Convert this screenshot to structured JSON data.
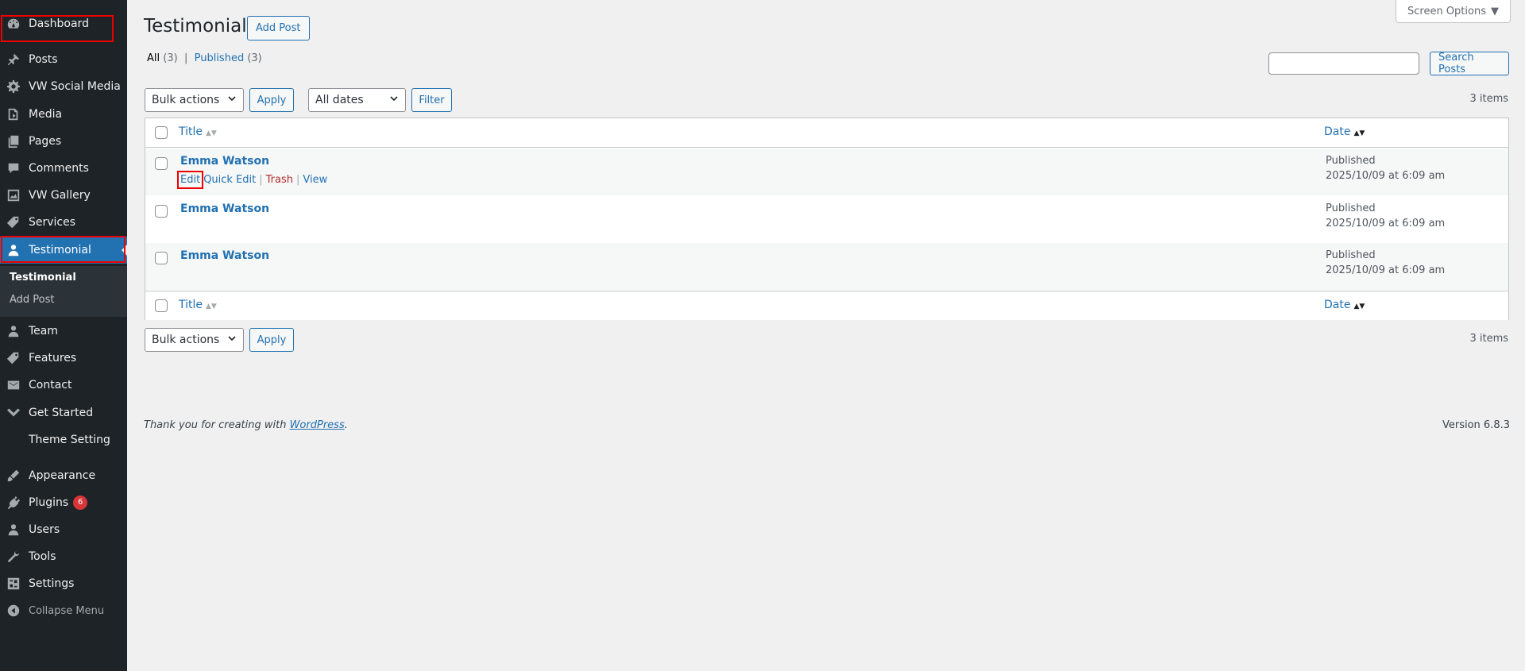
{
  "sidebar": {
    "items": [
      {
        "label": "Dashboard",
        "icon": "dashboard-icon"
      },
      {
        "label": "Posts",
        "icon": "pin-icon"
      },
      {
        "label": "VW Social Media",
        "icon": "gear-icon"
      },
      {
        "label": "Media",
        "icon": "media-icon"
      },
      {
        "label": "Pages",
        "icon": "pages-icon"
      },
      {
        "label": "Comments",
        "icon": "comments-icon"
      },
      {
        "label": "VW Gallery",
        "icon": "gallery-icon"
      },
      {
        "label": "Services",
        "icon": "tag-icon"
      },
      {
        "label": "Testimonial",
        "icon": "user-icon"
      },
      {
        "label": "Team",
        "icon": "user-icon"
      },
      {
        "label": "Features",
        "icon": "tag-icon"
      },
      {
        "label": "Contact",
        "icon": "mail-icon"
      },
      {
        "label": "Get Started",
        "icon": "chevron-down-icon"
      },
      {
        "label": "Theme Setting",
        "icon": ""
      },
      {
        "label": "Appearance",
        "icon": "brush-icon"
      },
      {
        "label": "Plugins",
        "icon": "plugin-icon",
        "badge": "6"
      },
      {
        "label": "Users",
        "icon": "user-icon"
      },
      {
        "label": "Tools",
        "icon": "wrench-icon"
      },
      {
        "label": "Settings",
        "icon": "settings-icon"
      }
    ],
    "submenu": [
      "Testimonial",
      "Add Post"
    ],
    "collapse_label": "Collapse Menu",
    "active_color": "#2271b1"
  },
  "header": {
    "title": "Testimonial",
    "add_post": "Add Post",
    "screen_options": "Screen Options"
  },
  "filters": {
    "all_label": "All",
    "all_count": "(3)",
    "separator": "|",
    "published_label": "Published",
    "published_count": "(3)",
    "search_button": "Search Posts",
    "bulk_actions": "Bulk actions",
    "apply": "Apply",
    "all_dates": "All dates",
    "filter": "Filter",
    "items_count": "3 items"
  },
  "table": {
    "col_title": "Title",
    "col_date": "Date",
    "rows": [
      {
        "title": "Emma Watson",
        "status": "Published",
        "date": "2025/10/09 at 6:09 am"
      },
      {
        "title": "Emma Watson",
        "status": "Published",
        "date": "2025/10/09 at 6:09 am"
      },
      {
        "title": "Emma Watson",
        "status": "Published",
        "date": "2025/10/09 at 6:09 am"
      }
    ],
    "row_actions": {
      "edit": "Edit",
      "quick_edit": "Quick Edit",
      "trash": "Trash",
      "view": "View",
      "sep": "|"
    }
  },
  "footer": {
    "thanks_prefix": "Thank you for creating with ",
    "wordpress": "WordPress",
    "thanks_suffix": ".",
    "version": "Version 6.8.3"
  }
}
